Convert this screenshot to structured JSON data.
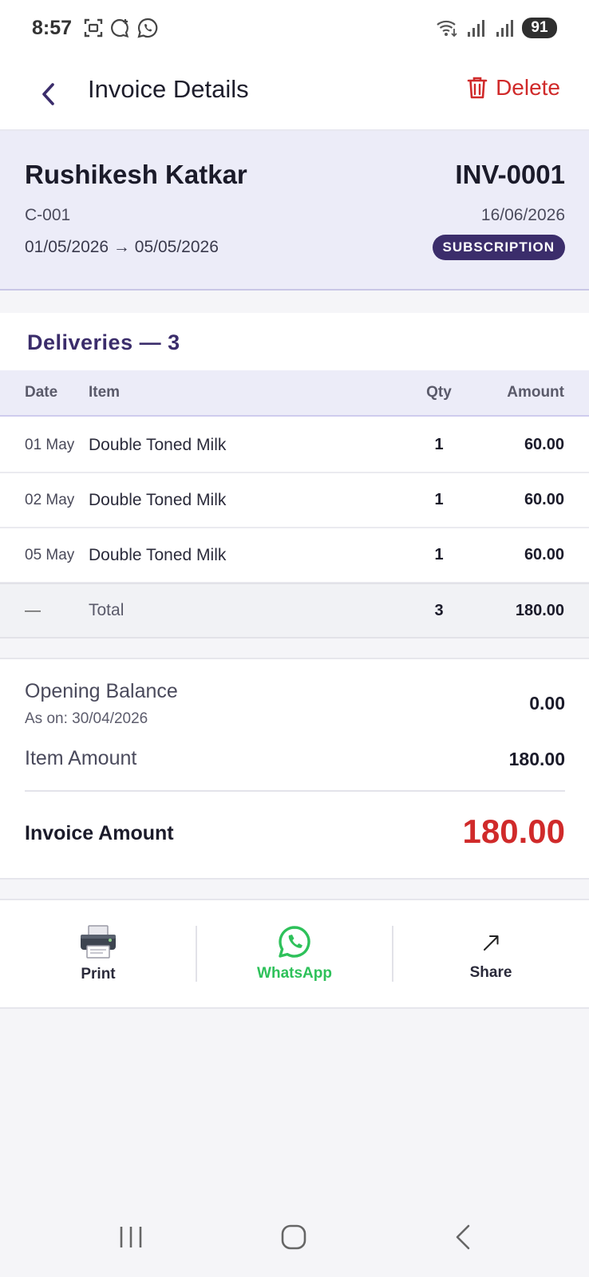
{
  "status_bar": {
    "time": "8:57",
    "battery": "91",
    "left_icons": [
      "screenshot-icon",
      "chat-plus-icon",
      "whatsapp-icon"
    ],
    "right_icons": [
      "wifi-icon",
      "signal-icon",
      "signal-icon"
    ]
  },
  "header": {
    "title": "Invoice Details",
    "delete_label": "Delete"
  },
  "invoice": {
    "customer_name": "Rushikesh Katkar",
    "customer_code": "C-001",
    "period": "01/05/2026 → 05/05/2026",
    "number": "INV-0001",
    "date": "16/06/2026",
    "type_badge": "SUBSCRIPTION"
  },
  "deliveries": {
    "title": "Deliveries — 3",
    "columns": {
      "date": "Date",
      "item": "Item",
      "qty": "Qty",
      "amount": "Amount"
    },
    "rows": [
      {
        "date": "01 May",
        "item": "Double Toned Milk",
        "qty": "1",
        "amount": "60.00"
      },
      {
        "date": "02 May",
        "item": "Double Toned Milk",
        "qty": "1",
        "amount": "60.00"
      },
      {
        "date": "05 May",
        "item": "Double Toned Milk",
        "qty": "1",
        "amount": "60.00"
      }
    ],
    "total": {
      "date": "—",
      "label": "Total",
      "qty": "3",
      "amount": "180.00"
    }
  },
  "summary": {
    "opening_balance_label": "Opening Balance",
    "opening_balance_sub": "As on: 30/04/2026",
    "opening_balance_value": "0.00",
    "item_amount_label": "Item Amount",
    "item_amount_value": "180.00",
    "invoice_amount_label": "Invoice Amount",
    "invoice_amount_value": "180.00"
  },
  "actions": {
    "print_label": "Print",
    "whatsapp_label": "WhatsApp",
    "share_label": "Share"
  },
  "colors": {
    "accent": "#3b2d6b",
    "danger": "#d02a2a",
    "whatsapp": "#2ec15a",
    "card_bg": "#ececf8"
  }
}
